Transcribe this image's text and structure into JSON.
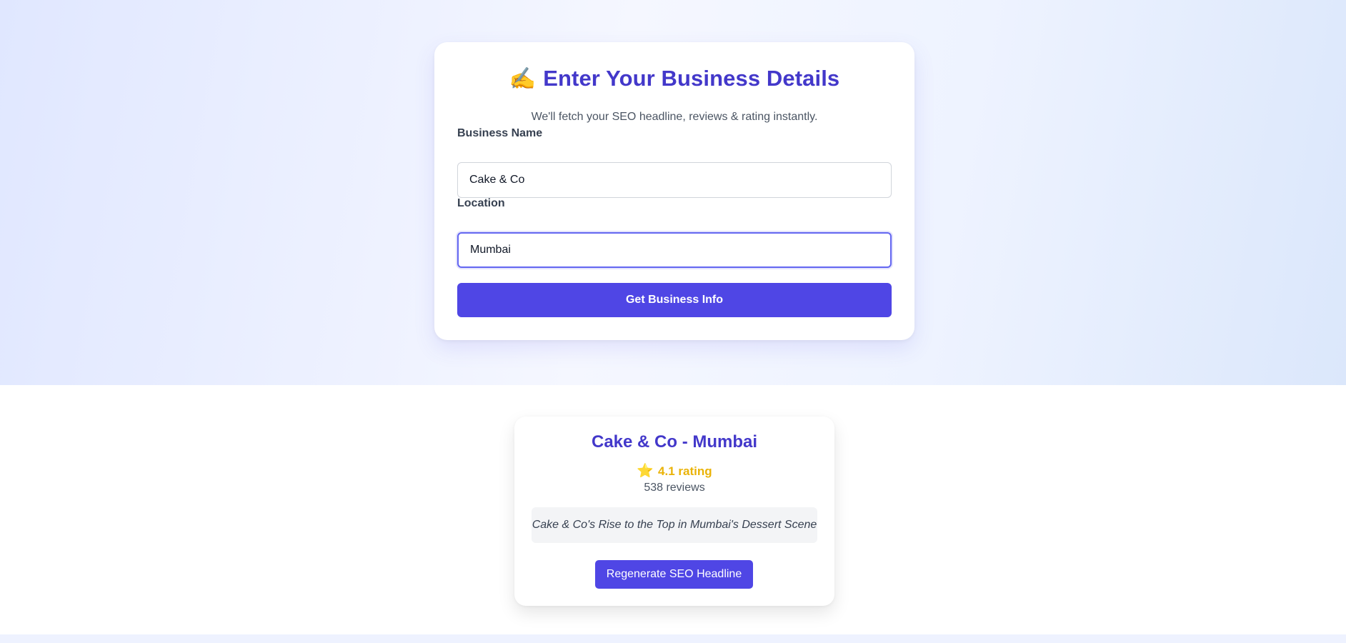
{
  "form": {
    "title_emoji": "✍️",
    "title": "Enter Your Business Details",
    "subtitle": "We'll fetch your SEO headline, reviews & rating instantly.",
    "business_name_label": "Business Name",
    "business_name_value": "Cake & Co",
    "location_label": "Location",
    "location_value": "Mumbai",
    "submit_label": "Get Business Info"
  },
  "result": {
    "title": "Cake & Co - Mumbai",
    "star_icon": "⭐",
    "rating_text": "4.1 rating",
    "rating_value": 4.1,
    "reviews_text": "538 reviews",
    "reviews_count": 538,
    "headline": "Cake & Co's Rise to the Top in Mumbai's Dessert Scene",
    "regenerate_label": "Regenerate SEO Headline"
  },
  "colors": {
    "accent": "#4f46e5",
    "title": "#4338ca",
    "rating": "#eab308"
  }
}
